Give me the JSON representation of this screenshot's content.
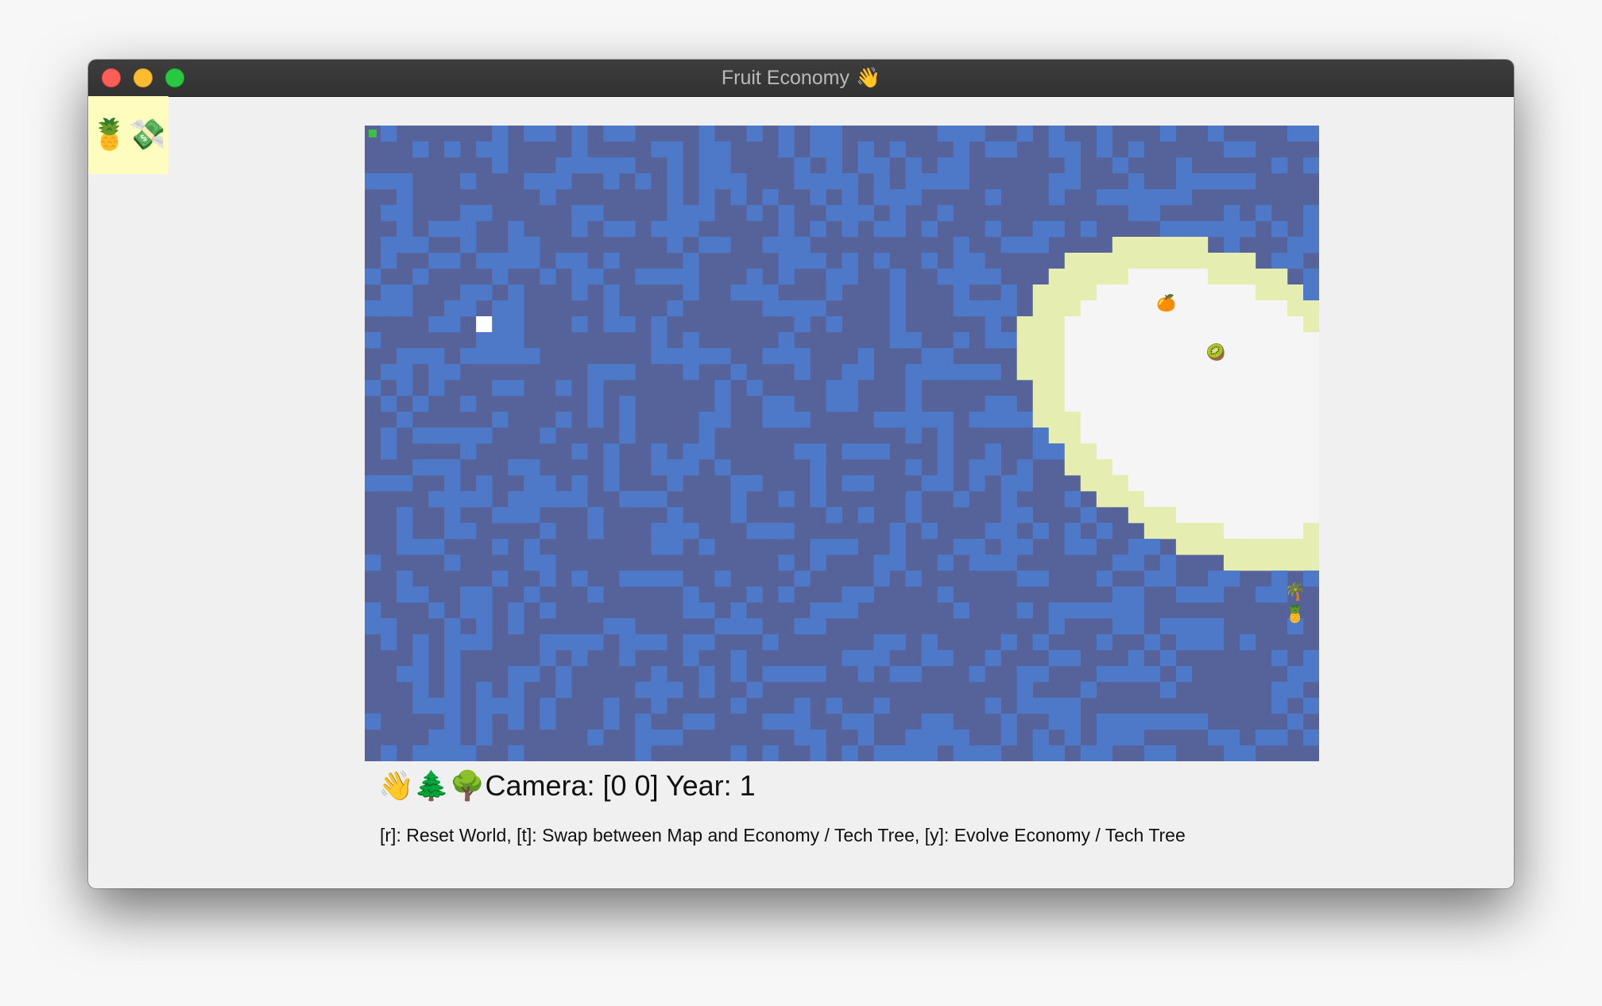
{
  "window": {
    "title": "Fruit Economy",
    "title_emoji": "👋"
  },
  "side_panel": {
    "icons": [
      {
        "icon": "pineapple-icon",
        "glyph": "🍍"
      },
      {
        "icon": "money-with-wings-icon",
        "glyph": "💸"
      }
    ]
  },
  "map": {
    "cols": 60,
    "rows": 40,
    "colors": {
      "deep_water": "#56629a",
      "shallow_water": "#4e78c8",
      "sand": "#e6edb1",
      "snow": "#f5f5f5",
      "cursor": "#ffffff",
      "marker": "#3fbf3f"
    },
    "entities": [
      {
        "name": "orange-icon",
        "glyph": "🍊"
      },
      {
        "name": "kiwi-icon",
        "glyph": "🥝"
      },
      {
        "name": "palm-tree-icon",
        "glyph": "🌴"
      },
      {
        "name": "pineapple-cut-icon",
        "glyph": "🍍"
      }
    ]
  },
  "status": {
    "icons": [
      "👋",
      "🌲",
      "🌳"
    ],
    "text": "Camera: [0 0] Year: 1"
  },
  "help": {
    "text": "[r]: Reset World, [t]: Swap between Map and Economy / Tech Tree, [y]: Evolve Economy / Tech Tree"
  }
}
